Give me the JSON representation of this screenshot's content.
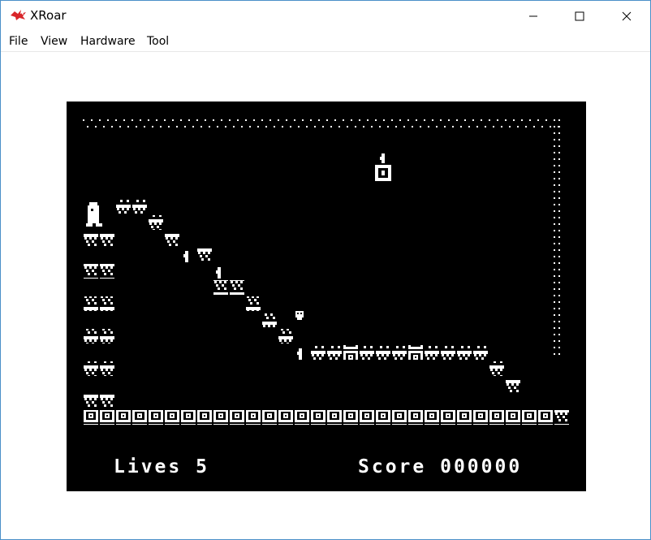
{
  "window": {
    "title": "XRoar",
    "icon": "dragon-icon",
    "controls": [
      "minimize-icon",
      "maximize-icon",
      "close-icon"
    ]
  },
  "menu": {
    "items": [
      {
        "label": "File"
      },
      {
        "label": "View"
      },
      {
        "label": "Hardware"
      },
      {
        "label": "Tool"
      }
    ]
  },
  "game": {
    "lives_label": "Lives",
    "lives_value": "5",
    "score_label": "Score",
    "score_value": "000000",
    "colors": {
      "background": "#000000",
      "foreground": "#ffffff"
    },
    "sprites": [
      "player-icon",
      "bell-icon",
      "skull-icon",
      "key-icon",
      "platform-block",
      "crate-block"
    ]
  }
}
